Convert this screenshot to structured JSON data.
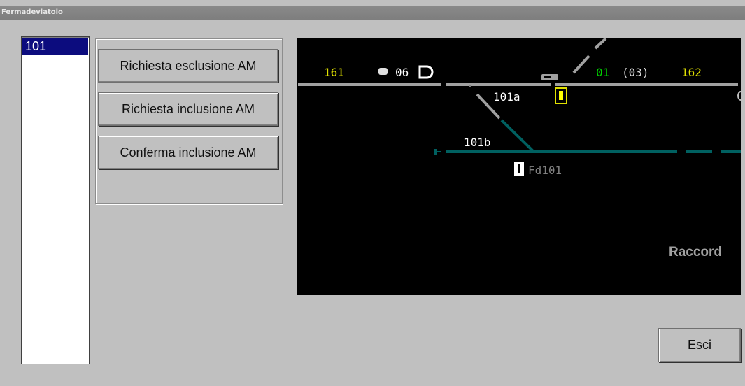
{
  "window": {
    "title": "Fermadeviatoio"
  },
  "list": {
    "items": [
      "101"
    ]
  },
  "actions": {
    "request_exclusion": "Richiesta esclusione AM",
    "request_inclusion": "Richiesta inclusione AM",
    "confirm_inclusion": "Conferma inclusione AM"
  },
  "schematic": {
    "label_161": "161",
    "label_06": "06",
    "label_01": "01",
    "label_03": "(03)",
    "label_162": "162",
    "label_101a": "101a",
    "label_101b": "101b",
    "label_fd101": "Fd101",
    "label_raccord": "Raccord"
  },
  "footer": {
    "exit": "Esci"
  },
  "colors": {
    "yellow": "#ffff00",
    "green": "#00cc00",
    "gray_track": "#a0a0a0",
    "teal_track": "#006060"
  }
}
